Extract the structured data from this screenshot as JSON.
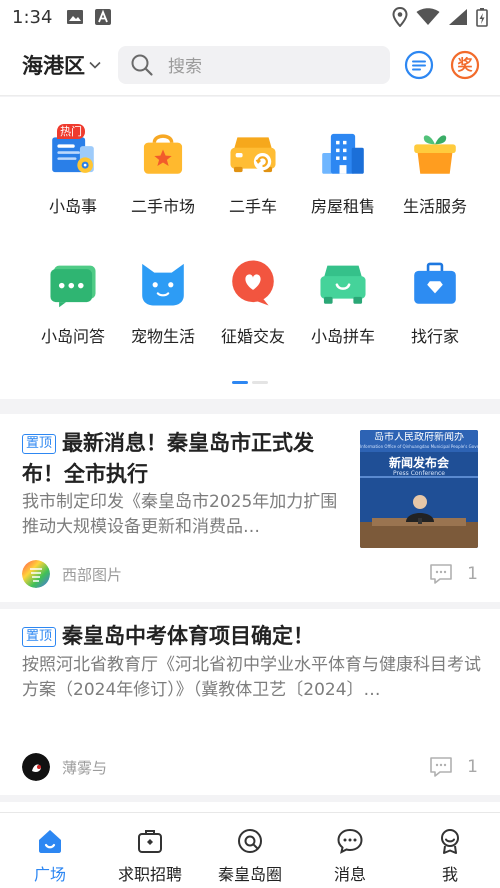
{
  "status_bar": {
    "time": "1:34"
  },
  "header": {
    "district": "海港区",
    "search_placeholder": "搜索",
    "chat_icon": "chat-icon",
    "award_icon": "award-icon",
    "award_label": "奖"
  },
  "categories": [
    {
      "label": "小岛事",
      "icon": "news-icon",
      "badge": "热门"
    },
    {
      "label": "二手市场",
      "icon": "shopping-bag-icon"
    },
    {
      "label": "二手车",
      "icon": "car-icon"
    },
    {
      "label": "房屋租售",
      "icon": "building-icon"
    },
    {
      "label": "生活服务",
      "icon": "gift-icon"
    },
    {
      "label": "小岛问答",
      "icon": "qa-icon"
    },
    {
      "label": "宠物生活",
      "icon": "pet-icon"
    },
    {
      "label": "征婚交友",
      "icon": "heart-chat-icon"
    },
    {
      "label": "小岛拼车",
      "icon": "carpool-icon"
    },
    {
      "label": "找行家",
      "icon": "briefcase-icon"
    }
  ],
  "carousel": {
    "pages": 2,
    "current": 1
  },
  "feed": [
    {
      "pin_label": "置顶",
      "title": "最新消息！秦皇岛市正式发布！全市执行",
      "summary": "我市制定印发《秦皇岛市2025年加力扩围推动大规模设备更新和消费品…",
      "author": "西部图片",
      "comments": "1",
      "thumbnail": {
        "banner": "岛市人民政府新闻办",
        "banner_sub": "Information Office of Qinhuangdao Municipal People's Government",
        "title": "新闻发布会",
        "subtitle": "Press Conference"
      }
    },
    {
      "pin_label": "置顶",
      "title": "秦皇岛中考体育项目确定！",
      "summary": "按照河北省教育厅《河北省初中学业水平体育与健康科目考试方案（2024年修订）》（冀教体卫艺〔2024〕…",
      "author": "薄雾与",
      "comments": "1"
    }
  ],
  "bottom_nav": [
    {
      "label": "广场",
      "icon": "home-icon",
      "active": true
    },
    {
      "label": "求职招聘",
      "icon": "briefcase-nav-icon"
    },
    {
      "label": "秦皇岛圈",
      "icon": "circle-icon"
    },
    {
      "label": "消息",
      "icon": "message-icon"
    },
    {
      "label": "我",
      "icon": "profile-icon"
    }
  ],
  "colors": {
    "accent": "#2d87f2",
    "award": "#f26b2b"
  }
}
